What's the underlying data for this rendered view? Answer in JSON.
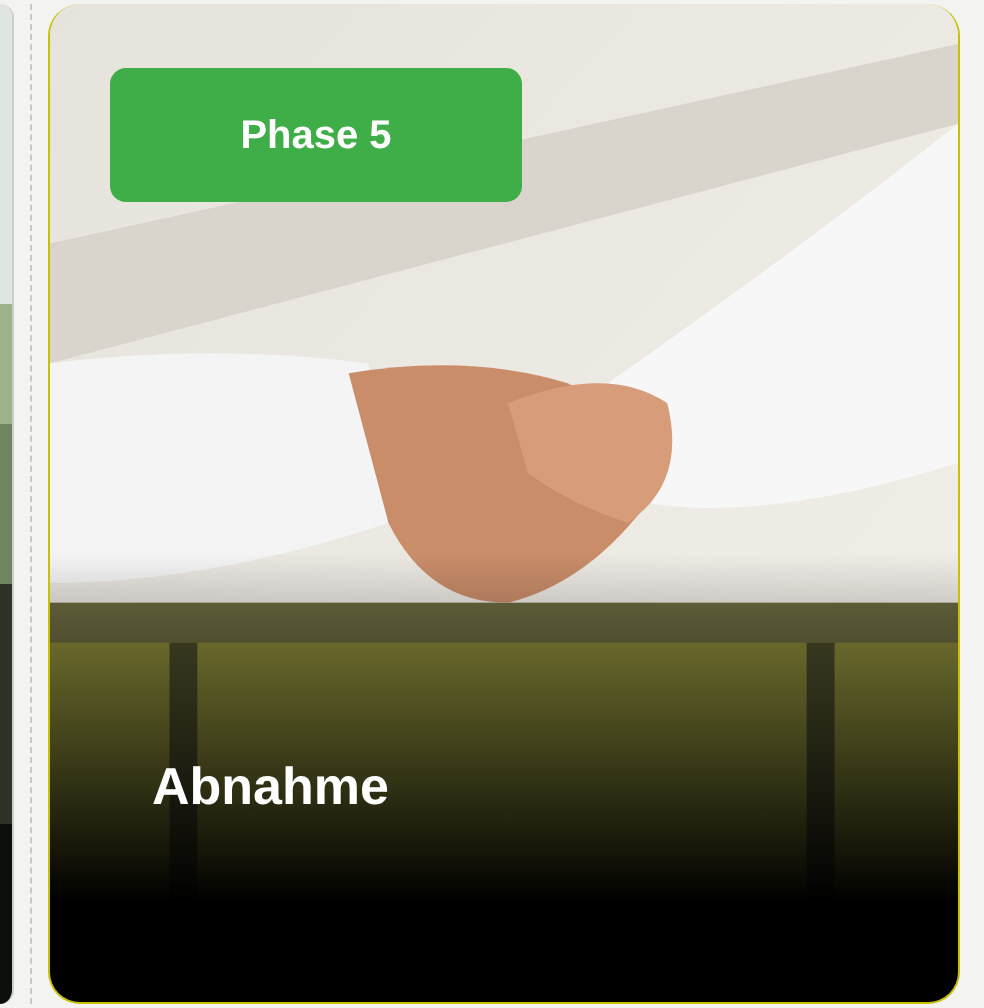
{
  "card": {
    "badge": "Phase 5",
    "title": "Abnahme"
  }
}
